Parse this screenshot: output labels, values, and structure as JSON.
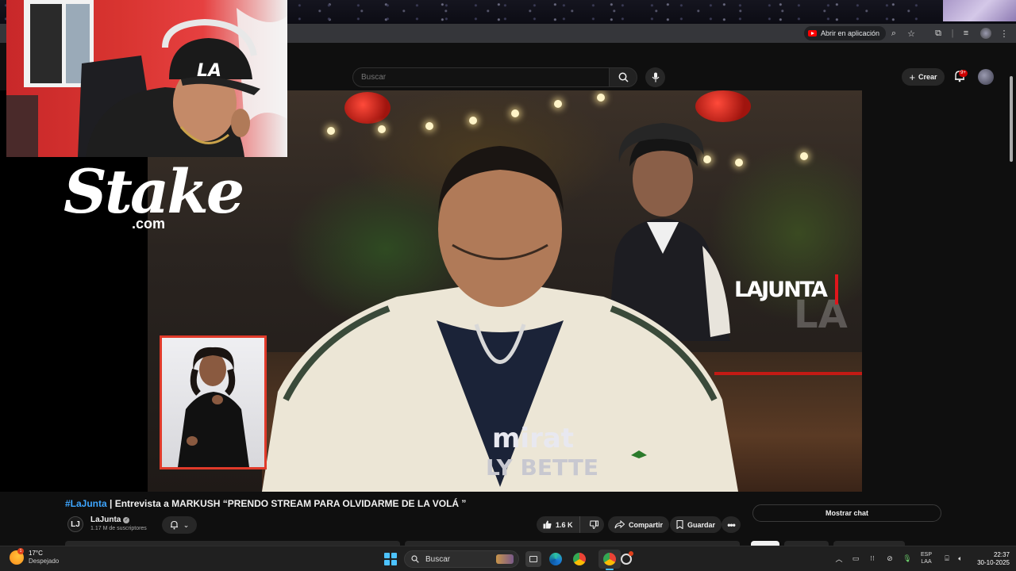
{
  "browser": {
    "open_in_app_label": "Abrir en aplicación"
  },
  "youtube_header": {
    "search_placeholder": "Buscar",
    "create_label": "Crear",
    "notifications_badge": "9+"
  },
  "overlay": {
    "sponsor_word": "Stake",
    "sponsor_domain": ".com",
    "show_logo": "LAJUNTA"
  },
  "video": {
    "title_hashtag": "#LaJunta",
    "title_rest": " | Entrevista a MARKUSH “PRENDO STREAM PARA OLVIDARME DE LA VOLÁ ”",
    "channel_name": "LaJunta",
    "channel_avatar_letter": "LJ",
    "subscribers": "1.17 M de suscriptores",
    "likes": "1.6 K",
    "share_label": "Compartir",
    "save_label": "Guardar",
    "show_chat_label": "Mostrar chat",
    "shirt_text_1": "mirat",
    "shirt_text_2": "LY BETTE"
  },
  "taskbar": {
    "temperature": "17°C",
    "weather_desc": "Despejado",
    "weather_badge": "1",
    "search_label": "Buscar",
    "lang_top": "ESP",
    "lang_bottom": "LAA",
    "time": "22:37",
    "date": "30-10-2025"
  },
  "colors": {
    "youtube_red": "#ff0000",
    "link_blue": "#3ea6ff",
    "interpreter_border": "#e03a2a",
    "windows_accent": "#4cc2ff"
  }
}
